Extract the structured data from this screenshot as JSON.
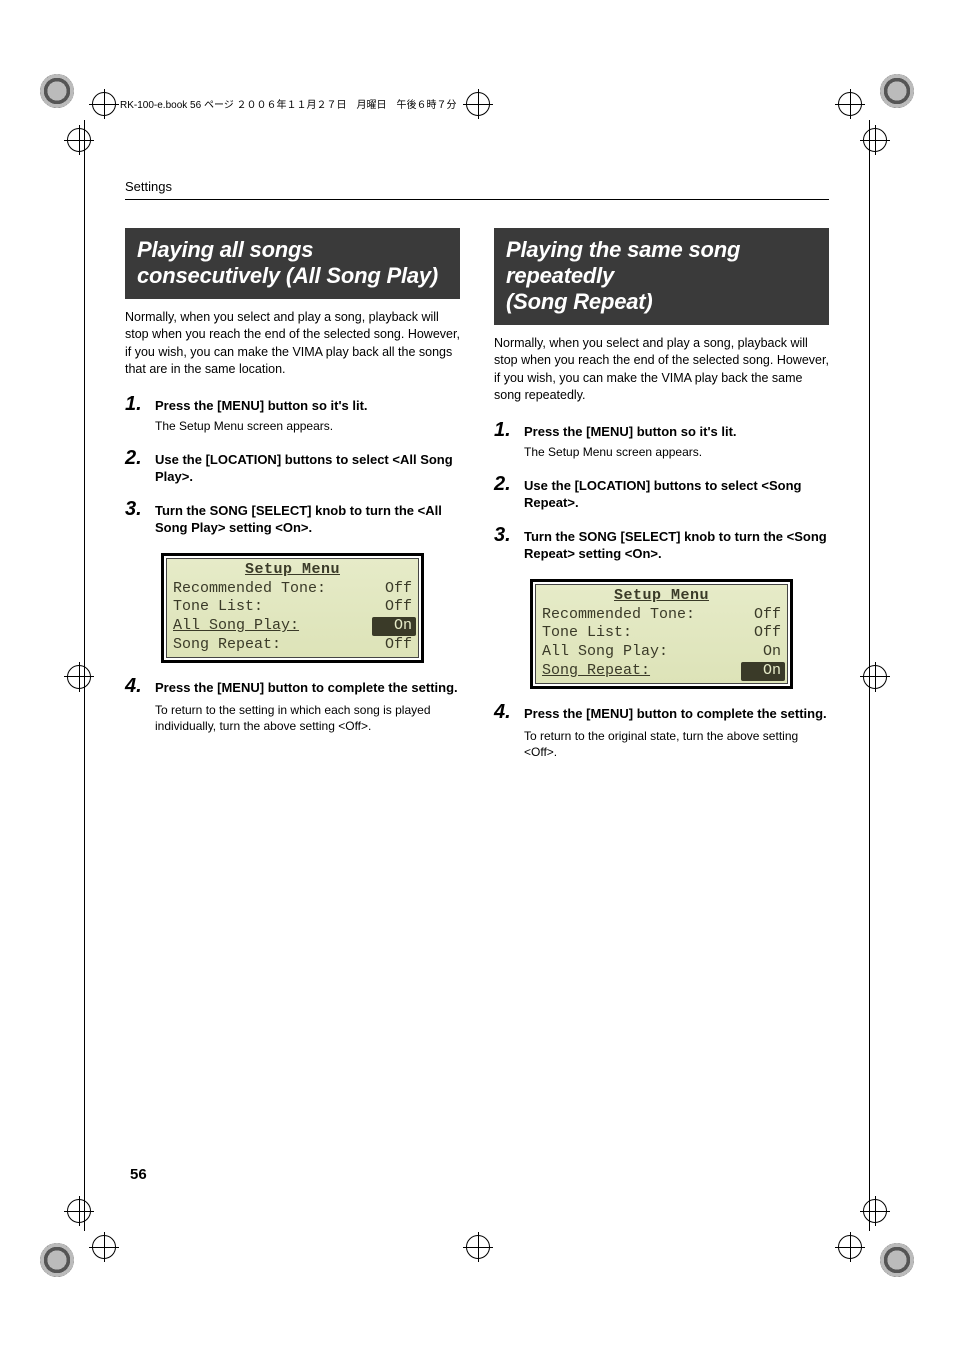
{
  "print_header": "RK-100-e.book  56 ページ  ２００６年１１月２７日　月曜日　午後６時７分",
  "section_label": "Settings",
  "page_number": "56",
  "left": {
    "heading": "Playing all songs consecutively (All Song Play)",
    "intro": "Normally, when you select and play a song, playback will stop when you reach the end of the selected song. However, if you wish, you can make the VIMA play back all the songs that are in the same location.",
    "steps": [
      {
        "num": "1.",
        "title": "Press the [MENU] button so it's lit.",
        "sub": "The Setup Menu screen appears."
      },
      {
        "num": "2.",
        "title": "Use the [LOCATION] buttons to select <All Song Play>."
      },
      {
        "num": "3.",
        "title": "Turn the SONG [SELECT] knob to turn the <All Song Play> setting <On>."
      },
      {
        "num": "4.",
        "title": "Press the [MENU] button to complete the setting.",
        "extra": "To return to the setting in which each song is played individually, turn the above setting <Off>."
      }
    ],
    "lcd": {
      "title": "Setup Menu",
      "rows": [
        {
          "label": "Recommended Tone:",
          "value": "Off",
          "highlighted": false,
          "selected": false
        },
        {
          "label": "Tone List:",
          "value": "Off",
          "highlighted": false,
          "selected": false
        },
        {
          "label": "All Song Play:",
          "value": "On",
          "highlighted": true,
          "selected": true
        },
        {
          "label": "Song Repeat:",
          "value": "Off",
          "highlighted": false,
          "selected": false
        }
      ]
    }
  },
  "right": {
    "heading": "Playing the same song repeatedly\n(Song Repeat)",
    "intro": "Normally, when you select and play a song, playback will stop when you reach the end of the selected song. However, if you wish, you can make the VIMA play back the same song repeatedly.",
    "steps": [
      {
        "num": "1.",
        "title": "Press the [MENU] button so it's lit.",
        "sub": "The Setup Menu screen appears."
      },
      {
        "num": "2.",
        "title": "Use the [LOCATION] buttons to select <Song Repeat>."
      },
      {
        "num": "3.",
        "title": "Turn the SONG [SELECT] knob to turn the <Song Repeat> setting <On>."
      },
      {
        "num": "4.",
        "title": "Press the [MENU] button to complete the setting.",
        "extra": "To return to the original state, turn the above setting <Off>."
      }
    ],
    "lcd": {
      "title": "Setup Menu",
      "rows": [
        {
          "label": "Recommended Tone:",
          "value": "Off",
          "highlighted": false,
          "selected": false
        },
        {
          "label": "Tone List:",
          "value": "Off",
          "highlighted": false,
          "selected": false
        },
        {
          "label": "All Song Play:",
          "value": "On",
          "highlighted": false,
          "selected": false
        },
        {
          "label": "Song Repeat:",
          "value": "On",
          "highlighted": true,
          "selected": true
        }
      ]
    }
  }
}
